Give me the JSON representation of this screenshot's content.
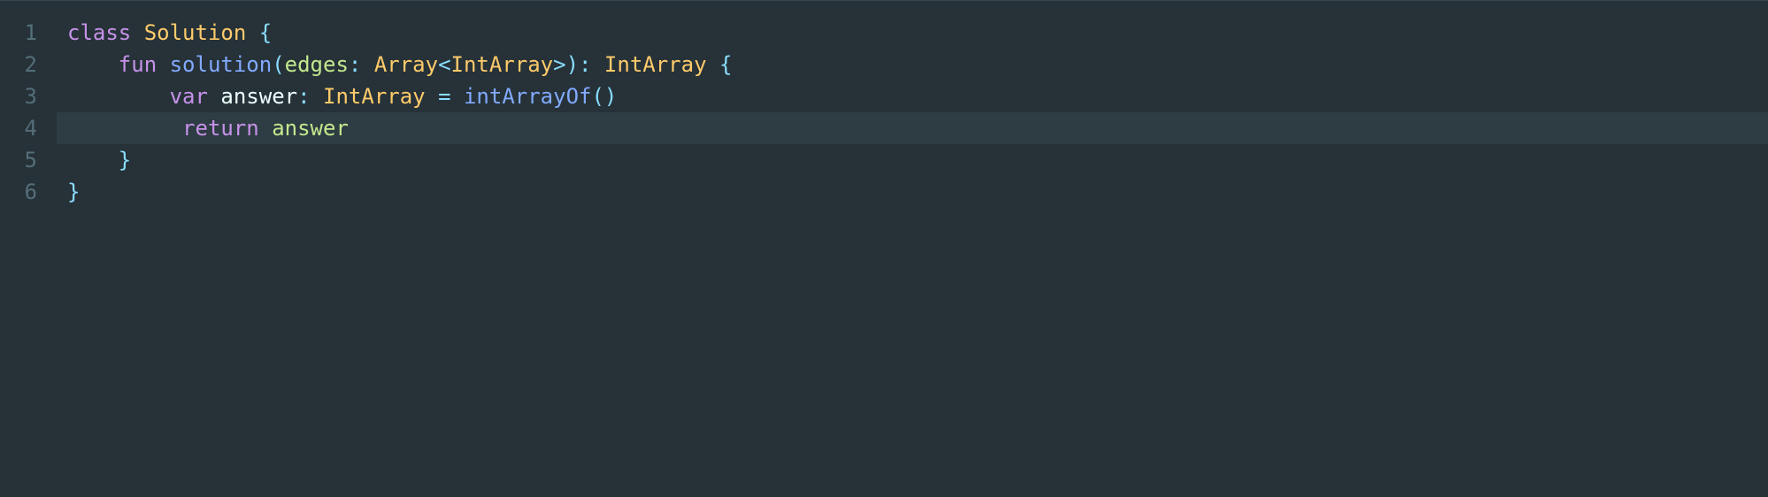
{
  "gutter": {
    "lines": [
      "1",
      "2",
      "3",
      "4",
      "5",
      "6"
    ]
  },
  "code": {
    "line1": {
      "kw_class": "class",
      "class_name": " Solution ",
      "brace": "{"
    },
    "line2": {
      "indent": "    ",
      "kw_fun": "fun",
      "space1": " ",
      "fn_name": "solution",
      "paren_open": "(",
      "param": "edges",
      "colon1": ":",
      "space2": " ",
      "type_array": "Array",
      "angle_open": "<",
      "type_intarray1": "IntArray",
      "angle_close": ">",
      "paren_close": ")",
      "colon2": ":",
      "space3": " ",
      "type_intarray2": "IntArray",
      "space4": " ",
      "brace": "{"
    },
    "line3": {
      "indent": "        ",
      "kw_var": "var",
      "space1": " ",
      "var_name": "answer",
      "colon": ":",
      "space2": " ",
      "type_intarray": "IntArray",
      "space3": " ",
      "equals": "=",
      "space4": " ",
      "fn_call": "intArrayOf",
      "parens": "()"
    },
    "line4": {
      "indent": "         ",
      "kw_return": "return",
      "space1": " ",
      "var_name": "answer"
    },
    "line5": {
      "indent": "    ",
      "brace": "}"
    },
    "line6": {
      "brace": "}"
    }
  }
}
